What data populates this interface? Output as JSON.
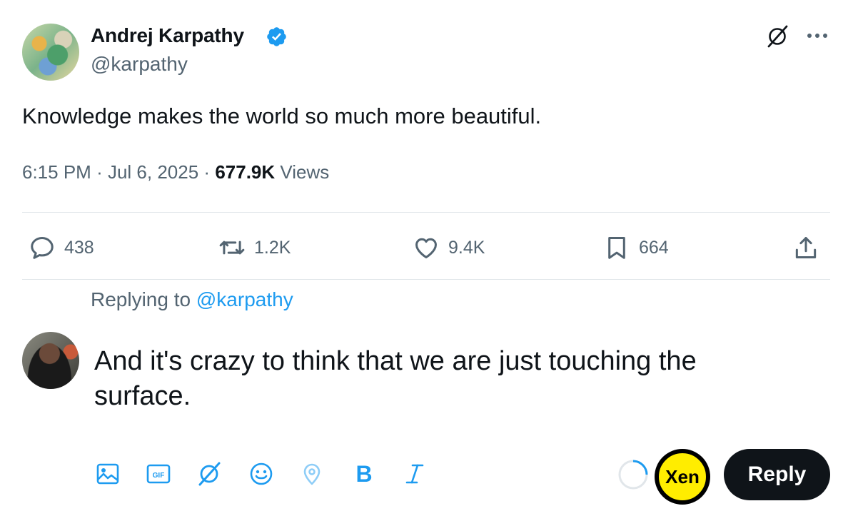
{
  "tweet": {
    "author_name": "Andrej Karpathy",
    "author_handle": "@karpathy",
    "text": "Knowledge makes the world so much more beautiful.",
    "time": "6:15 PM",
    "date": "Jul 6, 2025",
    "views_count": "677.9K",
    "views_label": "Views",
    "separator": "·"
  },
  "actions": {
    "replies": "438",
    "reposts": "1.2K",
    "likes": "9.4K",
    "bookmarks": "664"
  },
  "reply_composer": {
    "replying_prefix": "Replying to",
    "replying_handle": "@karpathy",
    "text": "And it's crazy to think that we are just touching the surface.",
    "xen_label": "Xen",
    "reply_button": "Reply"
  },
  "colors": {
    "accent": "#1d9bf0",
    "text": "#0f1419",
    "muted": "#536471",
    "divider": "#e1e6ea",
    "xen_yellow": "#ffed00"
  },
  "icons": {
    "verified": "verified-badge-icon",
    "grok": "grok-icon",
    "more": "more-options-icon",
    "reply": "reply-icon",
    "repost": "repost-icon",
    "like": "heart-icon",
    "bookmark": "bookmark-icon",
    "share": "share-icon",
    "tools": [
      "image-icon",
      "gif-icon",
      "grok-icon",
      "emoji-icon",
      "location-icon",
      "bold-icon",
      "italic-icon"
    ]
  }
}
